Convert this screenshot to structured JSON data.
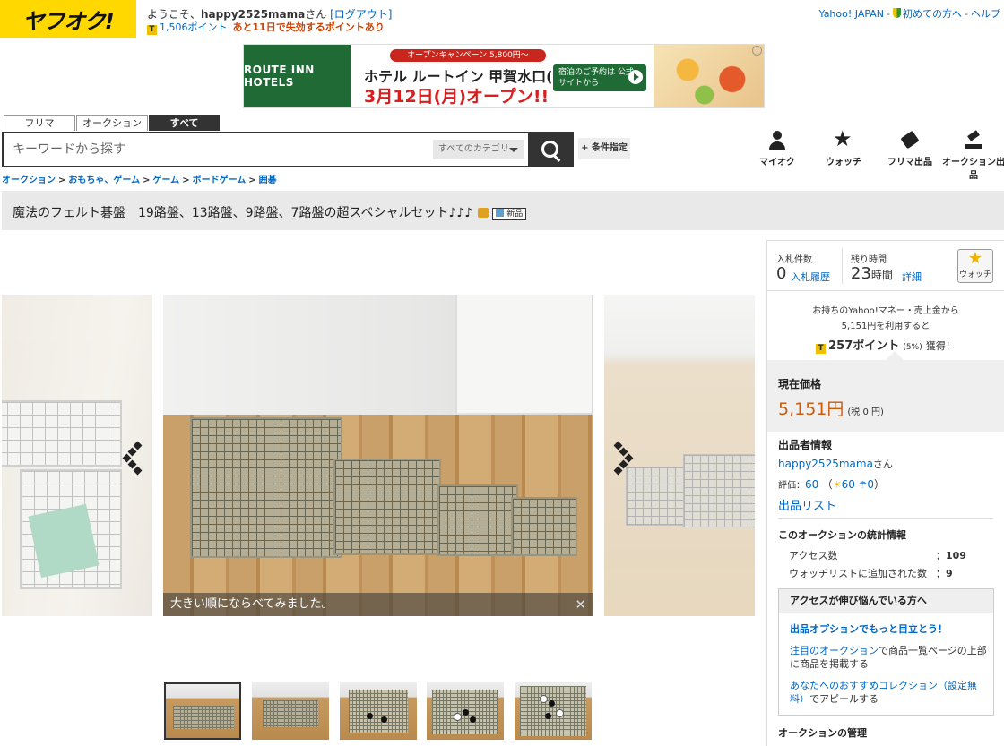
{
  "header": {
    "logo_text": "ヤフオク!",
    "welcome_prefix": "ようこそ、",
    "username": "happy2525mama",
    "welcome_suffix": "さん",
    "logout": "[ログアウト]",
    "points": "1,506ポイント",
    "expire_notice": "あと11日で失効するポイントあり",
    "links": {
      "yahoo_japan": "Yahoo! JAPAN",
      "first_time": "初めての方へ",
      "help": "ヘルプ"
    }
  },
  "banner": {
    "brand": "ROUTE INN HOTELS",
    "campaign": "オープンキャンペーン 5,800円〜",
    "hotel": "ホテル ルートイン 甲賀水口(滋賀県)",
    "opening": "3月12日(月)オープン!!",
    "cta": "宿泊のご予約は 公式サイトから"
  },
  "search": {
    "tabs": [
      "フリマ",
      "オークション",
      "すべて"
    ],
    "active_tab": "すべて",
    "placeholder": "キーワードから探す",
    "category": "すべてのカテゴリ",
    "advanced": "+ 条件指定"
  },
  "nav_icons": [
    {
      "label": "マイオク",
      "icon": "person-icon"
    },
    {
      "label": "ウォッチ",
      "icon": "star-icon"
    },
    {
      "label": "フリマ出品",
      "icon": "tag-icon"
    },
    {
      "label": "オークション出品",
      "icon": "gavel-icon"
    }
  ],
  "breadcrumb": [
    "オークション",
    "おもちゃ、ゲーム",
    "ゲーム",
    "ボードゲーム",
    "囲碁"
  ],
  "item": {
    "title": "魔法のフェルト碁盤　19路盤、13路盤、9路盤、7路盤の超スペシャルセット♪♪♪",
    "new_badge": "新品",
    "image_caption": "大きい順にならべてみました。",
    "thumbnail_count": 5
  },
  "bid": {
    "bids_label": "入札件数",
    "bids_value": "0",
    "bid_history": "入札履歴",
    "time_left_label": "残り時間",
    "time_left_value": "23",
    "time_left_unit": "時間",
    "details": "詳細",
    "watch_button": "ウォッチ"
  },
  "points_offer": {
    "line1": "お持ちのYahoo!マネー・売上金から",
    "line2": "5,151円を利用すると",
    "points": "257ポイント",
    "rate": "(5%)",
    "earn": "獲得！"
  },
  "price": {
    "label": "現在価格",
    "value": "5,151円",
    "tax": "(税 0 円)"
  },
  "seller": {
    "section_title": "出品者情報",
    "name": "happy2525mama",
    "name_suffix": "さん",
    "rating_label": "評価：",
    "rating": "60",
    "good": "60",
    "bad": "0",
    "listing_link": "出品リスト"
  },
  "stats": {
    "title": "このオークションの統計情報",
    "access_label": "アクセス数",
    "access_value": "109",
    "watchlist_label": "ウォッチリストに追加された数",
    "watchlist_value": "9"
  },
  "promo": {
    "header": "アクセスが伸び悩んでいる方へ",
    "headline": "出品オプションでもっと目立とう！",
    "item1_link": "注目のオークション",
    "item1_text": "で商品一覧ページの上部に商品を掲載する",
    "item2_link": "あなたへのおすすめコレクション（設定無料）",
    "item2_text": "でアピールする"
  },
  "manage_title": "オークションの管理",
  "colors": {
    "brand_yellow": "#ffd800",
    "price_orange": "#c65d10",
    "link_blue": "#0067c3"
  }
}
